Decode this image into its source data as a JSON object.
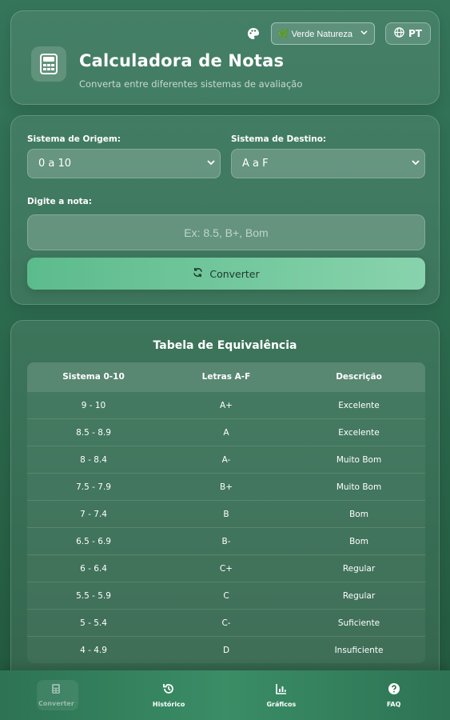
{
  "header": {
    "title": "Calculadora de Notas",
    "subtitle": "Converta entre diferentes sistemas de avaliação",
    "theme_select": "🌿 Verde Natureza",
    "language": "PT"
  },
  "converter": {
    "origin_label": "Sistema de Origem:",
    "origin_value": "0 a 10",
    "dest_label": "Sistema de Destino:",
    "dest_value": "A a F",
    "input_label": "Digite a nota:",
    "input_placeholder": "Ex: 8.5, B+, Bom",
    "convert_button": "Converter"
  },
  "table": {
    "title": "Tabela de Equivalência",
    "columns": [
      "Sistema 0-10",
      "Letras A-F",
      "Descrição"
    ],
    "rows": [
      [
        "9 - 10",
        "A+",
        "Excelente"
      ],
      [
        "8.5 - 8.9",
        "A",
        "Excelente"
      ],
      [
        "8 - 8.4",
        "A-",
        "Muito Bom"
      ],
      [
        "7.5 - 7.9",
        "B+",
        "Muito Bom"
      ],
      [
        "7 - 7.4",
        "B",
        "Bom"
      ],
      [
        "6.5 - 6.9",
        "B-",
        "Bom"
      ],
      [
        "6 - 6.4",
        "C+",
        "Regular"
      ],
      [
        "5.5 - 5.9",
        "C",
        "Regular"
      ],
      [
        "5 - 5.4",
        "C-",
        "Suficiente"
      ],
      [
        "4 - 4.9",
        "D",
        "Insuficiente"
      ]
    ]
  },
  "nav": {
    "items": [
      {
        "label": "Converter",
        "icon": "calculator-icon"
      },
      {
        "label": "Histórico",
        "icon": "history-icon"
      },
      {
        "label": "Gráficos",
        "icon": "chart-icon"
      },
      {
        "label": "FAQ",
        "icon": "question-icon"
      }
    ]
  },
  "colors": {
    "background": "#2c6a4e",
    "accent": "#5cbb8c",
    "accent_light": "#88d3ad"
  }
}
